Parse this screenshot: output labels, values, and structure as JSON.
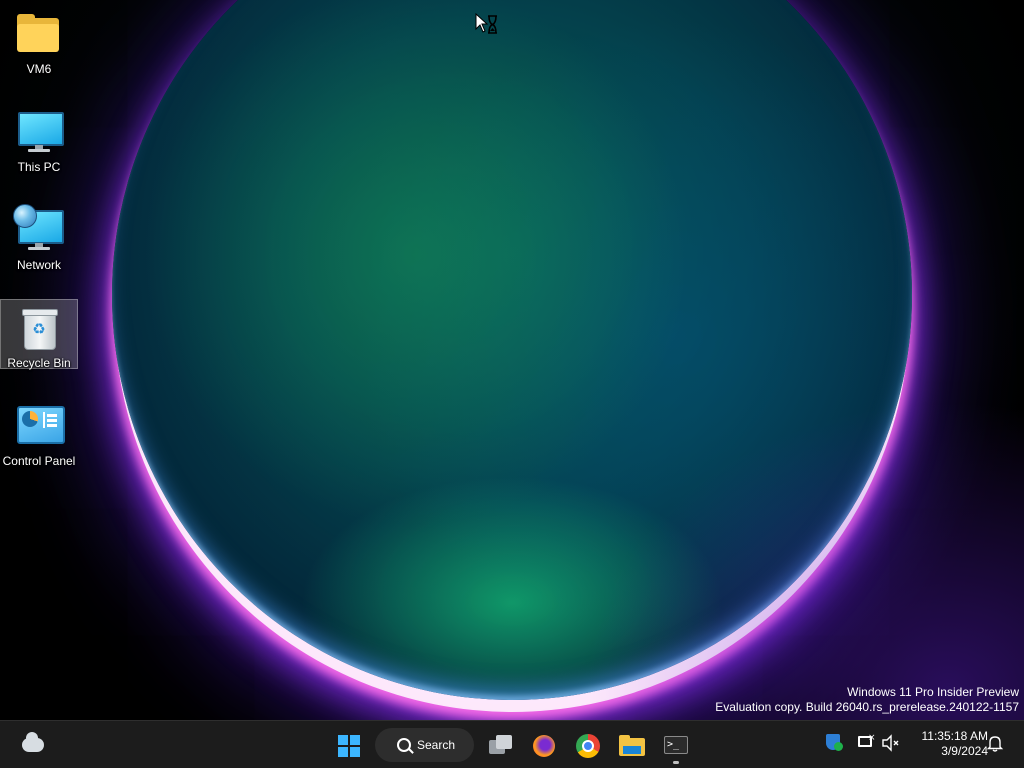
{
  "desktop": {
    "icons": [
      {
        "label": "VM6",
        "icon": "folder-icon"
      },
      {
        "label": "This PC",
        "icon": "computer-icon"
      },
      {
        "label": "Network",
        "icon": "network-icon"
      },
      {
        "label": "Recycle Bin",
        "icon": "recycle-bin-icon",
        "selected": true
      },
      {
        "label": "Control Panel",
        "icon": "control-panel-icon"
      }
    ],
    "cursor": "busy-cursor-icon"
  },
  "watermark": {
    "line1": "Windows 11 Pro Insider Preview",
    "line2": "Evaluation copy. Build 26040.rs_prerelease.240122-1157"
  },
  "taskbar": {
    "weather_icon": "weather-cloud-icon",
    "start_icon": "windows-start-icon",
    "search_label": "Search",
    "apps": [
      {
        "name": "Task View",
        "icon": "task-view-icon"
      },
      {
        "name": "Firefox",
        "icon": "firefox-icon"
      },
      {
        "name": "Google Chrome",
        "icon": "chrome-icon"
      },
      {
        "name": "File Explorer",
        "icon": "file-explorer-icon"
      },
      {
        "name": "Terminal",
        "icon": "terminal-icon",
        "running": true
      }
    ],
    "tray": {
      "security_icon": "windows-security-icon",
      "network_icon": "network-disconnected-icon",
      "volume_icon": "volume-muted-icon",
      "time": "11:35:18 AM",
      "date": "3/9/2024",
      "notification_icon": "notification-bell-icon"
    },
    "colors": {
      "background": "#1c1c1c",
      "search_bg": "#2d2d2d",
      "accent": "#3cb6ff"
    }
  }
}
